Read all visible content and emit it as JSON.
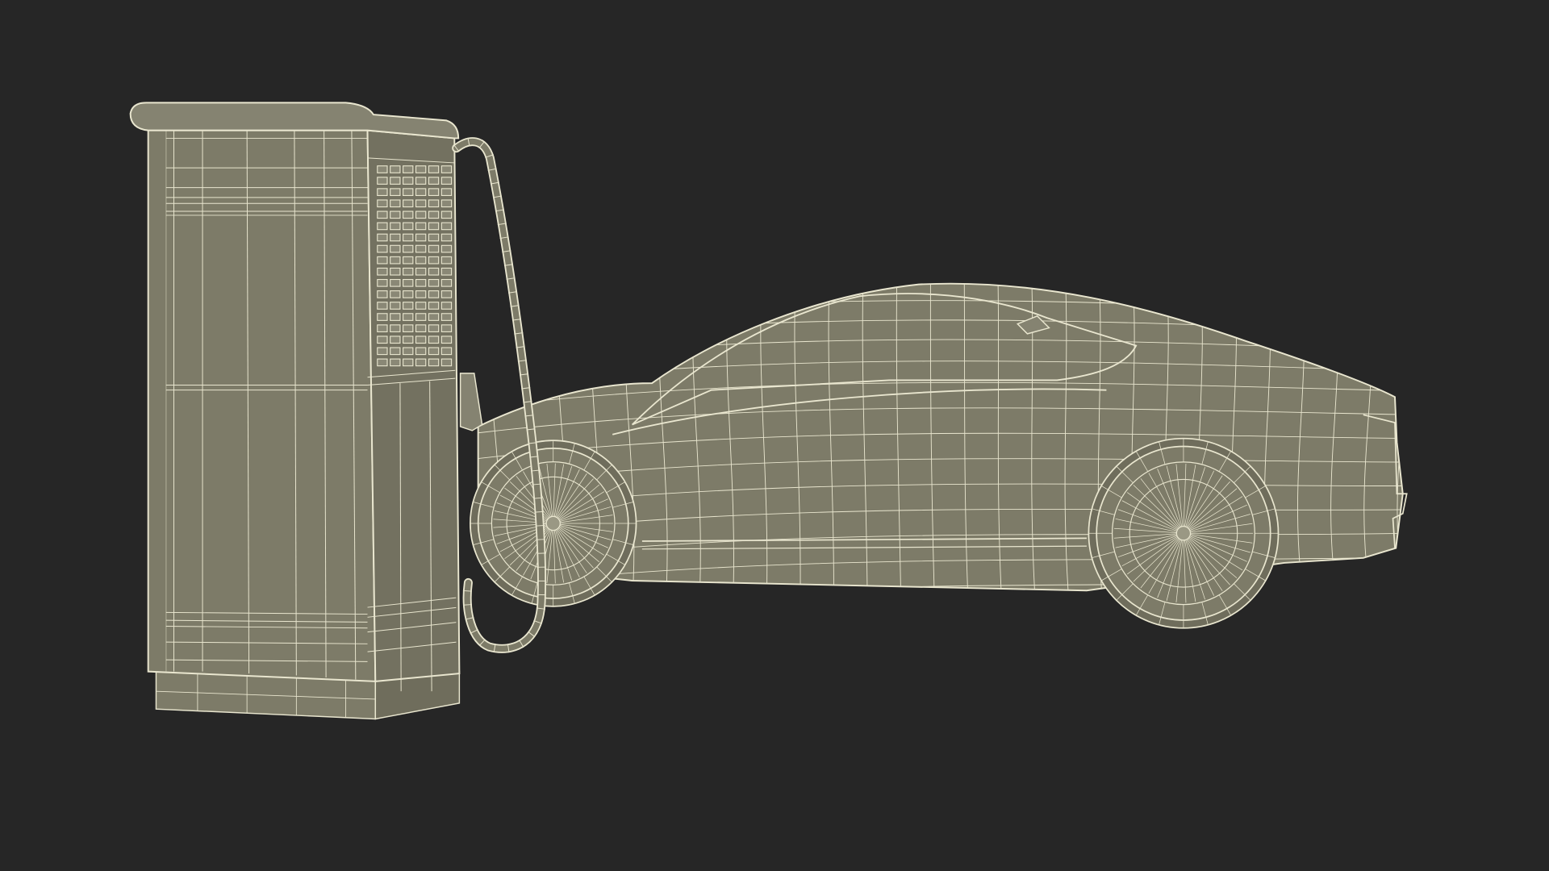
{
  "scene": {
    "background_color": "#262626",
    "fill_color": "#7d7b68",
    "wire_color": "#e9e6cf",
    "objects": [
      {
        "id": "ev-charging-station",
        "style": "wireframe"
      },
      {
        "id": "charging-cable",
        "style": "wireframe"
      },
      {
        "id": "sports-car",
        "style": "wireframe"
      }
    ]
  }
}
